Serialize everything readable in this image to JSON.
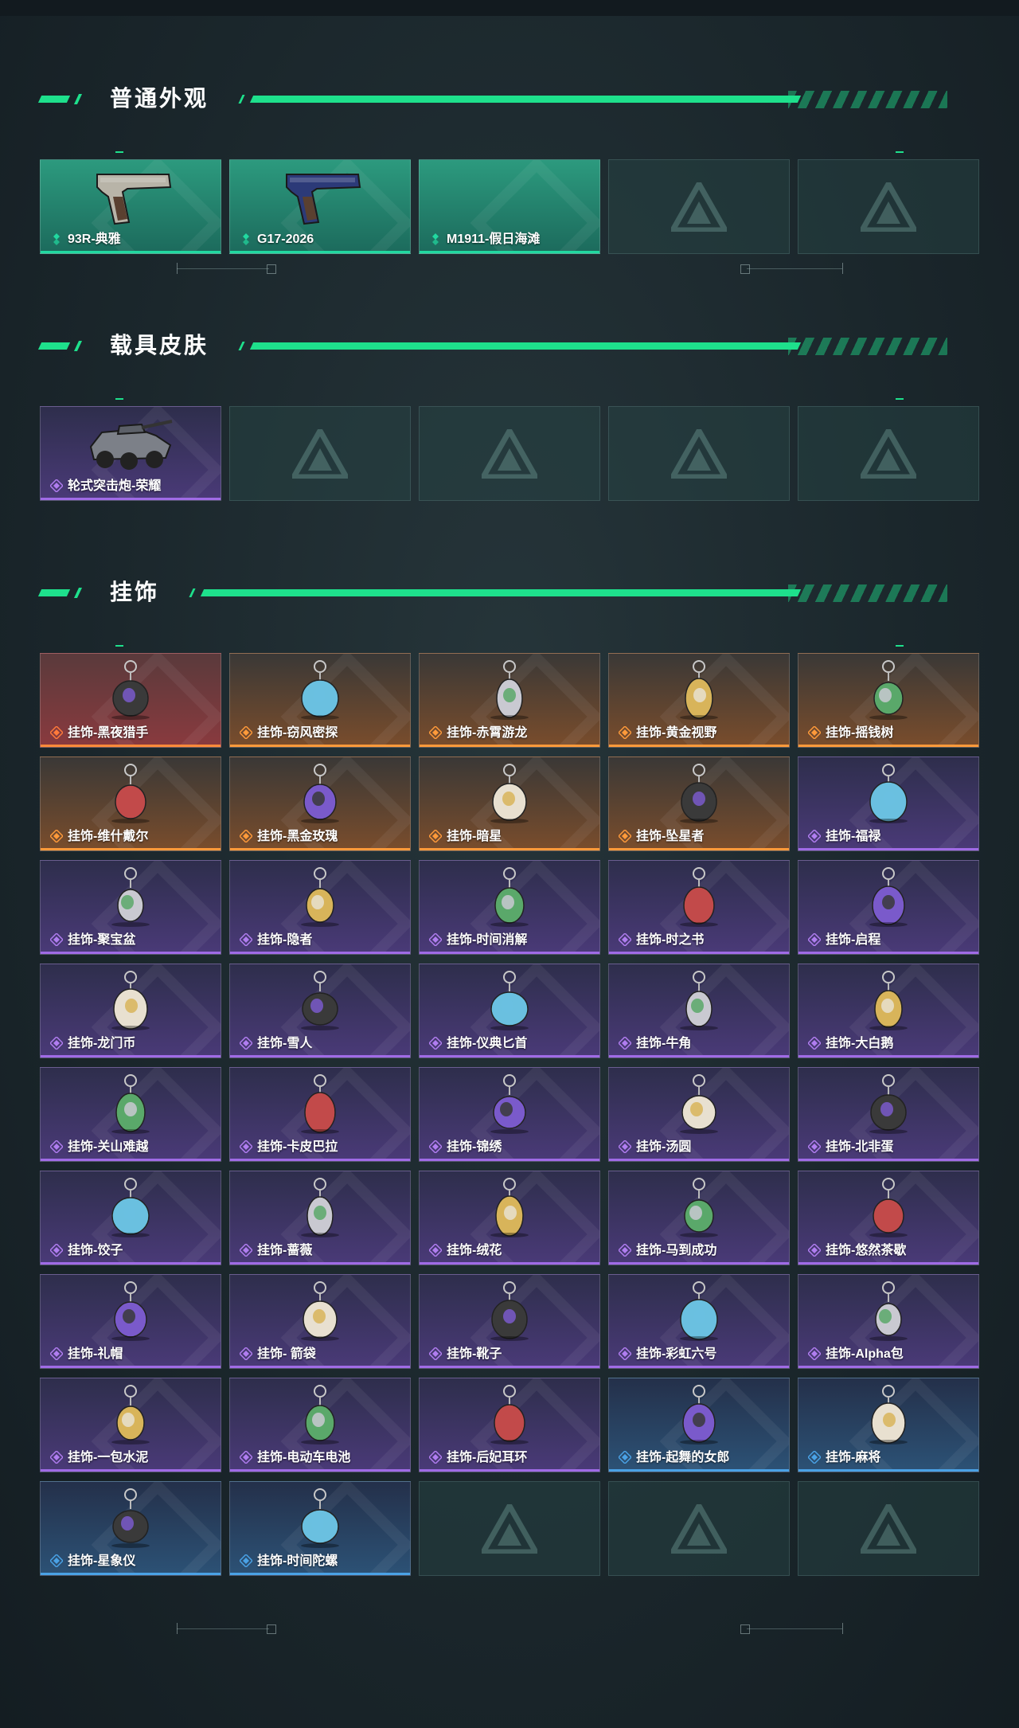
{
  "sections": [
    {
      "title": "普通外观",
      "items": [
        {
          "name": "93R-典雅",
          "rarity": "green",
          "icon": "pistol-silver-icon"
        },
        {
          "name": "G17-2026",
          "rarity": "green",
          "icon": "pistol-blue-icon"
        },
        {
          "name": "M1911-假日海滩",
          "rarity": "green",
          "icon": ""
        },
        {
          "name": "",
          "rarity": "empty"
        },
        {
          "name": "",
          "rarity": "empty"
        }
      ]
    },
    {
      "title": "载具皮肤",
      "items": [
        {
          "name": "轮式突击炮-荣耀",
          "rarity": "purple",
          "icon": "armored-vehicle-icon"
        },
        {
          "name": "",
          "rarity": "empty"
        },
        {
          "name": "",
          "rarity": "empty"
        },
        {
          "name": "",
          "rarity": "empty"
        },
        {
          "name": "",
          "rarity": "empty"
        }
      ]
    },
    {
      "title": "挂饰",
      "items": [
        {
          "name": "挂饰-黑夜猎手",
          "rarity": "red",
          "icon": "charm-icon"
        },
        {
          "name": "挂饰-窃风密探",
          "rarity": "orange",
          "icon": "charm-icon"
        },
        {
          "name": "挂饰-赤霄游龙",
          "rarity": "orange",
          "icon": "charm-icon"
        },
        {
          "name": "挂饰-黄金视野",
          "rarity": "orange",
          "icon": "charm-icon"
        },
        {
          "name": "挂饰-摇钱树",
          "rarity": "orange",
          "icon": "charm-icon"
        },
        {
          "name": "挂饰-维什戴尔",
          "rarity": "orange",
          "icon": "charm-icon"
        },
        {
          "name": "挂饰-黑金玫瑰",
          "rarity": "orange",
          "icon": "charm-icon"
        },
        {
          "name": "挂饰-暗星",
          "rarity": "orange",
          "icon": "charm-icon"
        },
        {
          "name": "挂饰-坠星者",
          "rarity": "orange",
          "icon": "charm-icon"
        },
        {
          "name": "挂饰-福禄",
          "rarity": "purple",
          "icon": "charm-icon"
        },
        {
          "name": "挂饰-聚宝盆",
          "rarity": "purple",
          "icon": "charm-icon"
        },
        {
          "name": "挂饰-隐者",
          "rarity": "purple",
          "icon": "charm-icon"
        },
        {
          "name": "挂饰-时间消解",
          "rarity": "purple",
          "icon": "charm-icon"
        },
        {
          "name": "挂饰-时之书",
          "rarity": "purple",
          "icon": "charm-icon"
        },
        {
          "name": "挂饰-启程",
          "rarity": "purple",
          "icon": "charm-icon"
        },
        {
          "name": "挂饰-龙门币",
          "rarity": "purple",
          "icon": "charm-icon"
        },
        {
          "name": "挂饰-雪人",
          "rarity": "purple",
          "icon": "charm-icon"
        },
        {
          "name": "挂饰-仪典匕首",
          "rarity": "purple",
          "icon": "charm-icon"
        },
        {
          "name": "挂饰-牛角",
          "rarity": "purple",
          "icon": "charm-icon"
        },
        {
          "name": "挂饰-大白鹅",
          "rarity": "purple",
          "icon": "charm-icon"
        },
        {
          "name": "挂饰-关山难越",
          "rarity": "purple",
          "icon": "charm-icon"
        },
        {
          "name": "挂饰-卡皮巴拉",
          "rarity": "purple",
          "icon": "charm-icon"
        },
        {
          "name": "挂饰-锦绣",
          "rarity": "purple",
          "icon": "charm-icon"
        },
        {
          "name": "挂饰-汤圆",
          "rarity": "purple",
          "icon": "charm-icon"
        },
        {
          "name": "挂饰-北非蛋",
          "rarity": "purple",
          "icon": "charm-icon"
        },
        {
          "name": "挂饰-饺子",
          "rarity": "purple",
          "icon": "charm-icon"
        },
        {
          "name": "挂饰-蔷薇",
          "rarity": "purple",
          "icon": "charm-icon"
        },
        {
          "name": "挂饰-绒花",
          "rarity": "purple",
          "icon": "charm-icon"
        },
        {
          "name": "挂饰-马到成功",
          "rarity": "purple",
          "icon": "charm-icon"
        },
        {
          "name": "挂饰-悠然茶歇",
          "rarity": "purple",
          "icon": "charm-icon"
        },
        {
          "name": "挂饰-礼帽",
          "rarity": "purple",
          "icon": "charm-icon"
        },
        {
          "name": "挂饰- 箭袋",
          "rarity": "purple",
          "icon": "charm-icon"
        },
        {
          "name": "挂饰-靴子",
          "rarity": "purple",
          "icon": "charm-icon"
        },
        {
          "name": "挂饰-彩虹六号",
          "rarity": "purple",
          "icon": "charm-icon"
        },
        {
          "name": "挂饰-Alpha包",
          "rarity": "purple",
          "icon": "charm-icon"
        },
        {
          "name": "挂饰-一包水泥",
          "rarity": "purple",
          "icon": "charm-icon"
        },
        {
          "name": "挂饰-电动车电池",
          "rarity": "purple",
          "icon": "charm-icon"
        },
        {
          "name": "挂饰-后妃耳环",
          "rarity": "purple",
          "icon": "charm-icon"
        },
        {
          "name": "挂饰-起舞的女郎",
          "rarity": "blue",
          "icon": "charm-icon"
        },
        {
          "name": "挂饰-麻将",
          "rarity": "blue",
          "icon": "charm-icon"
        },
        {
          "name": "挂饰-星象仪",
          "rarity": "blue",
          "icon": "charm-icon"
        },
        {
          "name": "挂饰-时间陀螺",
          "rarity": "blue",
          "icon": "charm-icon"
        },
        {
          "name": "",
          "rarity": "empty"
        },
        {
          "name": "",
          "rarity": "empty"
        },
        {
          "name": "",
          "rarity": "empty"
        }
      ]
    }
  ],
  "colors": {
    "accent": "#1ee08c",
    "green": "#21d9a0",
    "red": "#ff8a3a",
    "orange": "#ff9a3a",
    "purple": "#a06be6",
    "blue": "#4aa2e6"
  }
}
